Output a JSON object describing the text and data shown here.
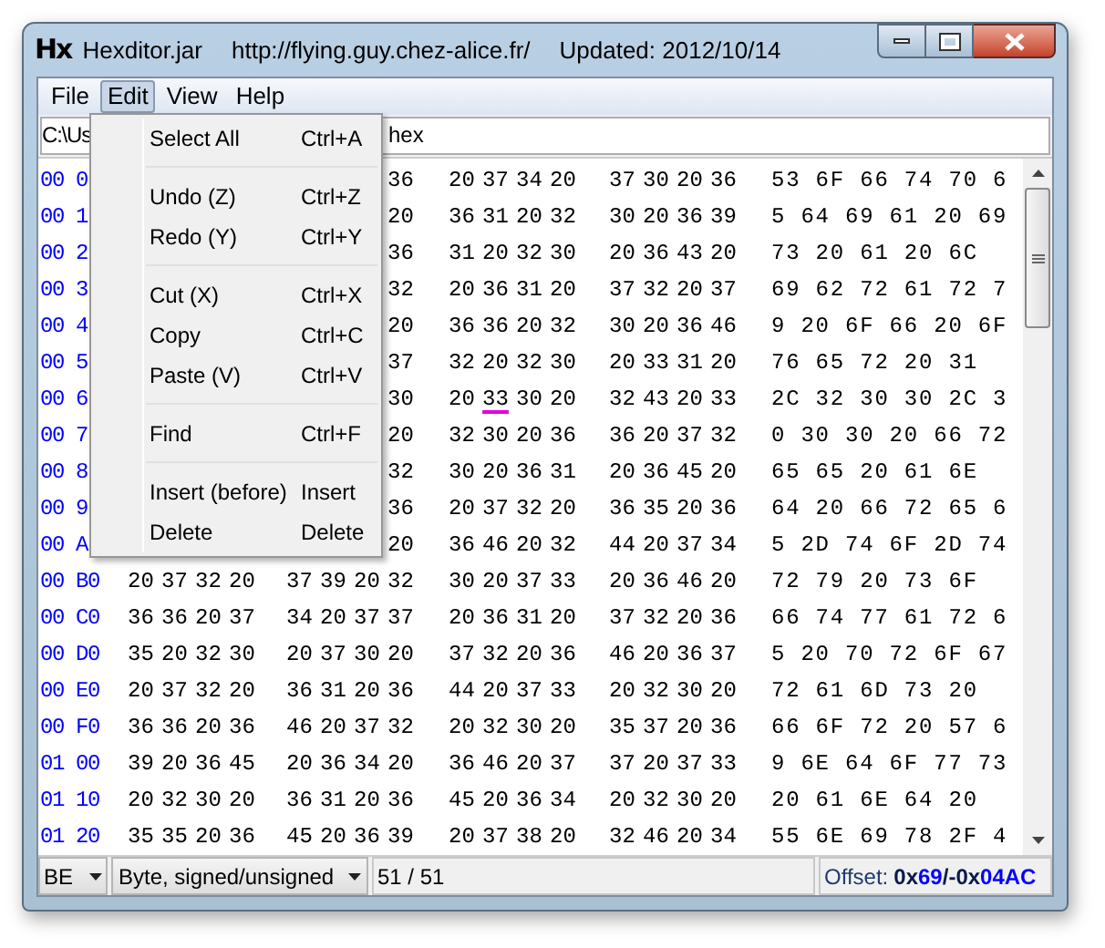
{
  "window": {
    "app_icon": "Hx",
    "title_parts": [
      "Hexditor.jar",
      "http://flying.guy.chez-alice.fr/",
      "Updated: 2012/10/14"
    ]
  },
  "menu_bar": [
    {
      "label": "File",
      "selected": false
    },
    {
      "label": "Edit",
      "selected": true
    },
    {
      "label": "View",
      "selected": false
    },
    {
      "label": "Help",
      "selected": false
    }
  ],
  "path_field": {
    "value_parts": [
      "C:\\Us",
      "hex"
    ]
  },
  "edit_menu": [
    {
      "kind": "item",
      "label": "Select All",
      "shortcut": "Ctrl+A"
    },
    {
      "kind": "separator"
    },
    {
      "kind": "item",
      "label": "Undo (Z)",
      "shortcut": "Ctrl+Z"
    },
    {
      "kind": "item",
      "label": "Redo (Y)",
      "shortcut": "Ctrl+Y"
    },
    {
      "kind": "separator"
    },
    {
      "kind": "item",
      "label": "Cut (X)",
      "shortcut": "Ctrl+X"
    },
    {
      "kind": "item",
      "label": "Copy",
      "shortcut": "Ctrl+C"
    },
    {
      "kind": "item",
      "label": "Paste (V)",
      "shortcut": "Ctrl+V"
    },
    {
      "kind": "separator"
    },
    {
      "kind": "item",
      "label": "Find",
      "shortcut": "Ctrl+F"
    },
    {
      "kind": "separator"
    },
    {
      "kind": "item",
      "label": "Insert (before)",
      "shortcut": "Insert"
    },
    {
      "kind": "item",
      "label": "Delete",
      "shortcut": "Delete"
    }
  ],
  "hex_rows": [
    {
      "address": "00 0",
      "groups": [
        [
          "36"
        ],
        [
          "20",
          "37",
          "34",
          "20"
        ],
        [
          "37",
          "30",
          "20",
          "36"
        ]
      ],
      "text": "53 6F 66 74 70 6"
    },
    {
      "address": "00 1",
      "groups": [
        [
          "20"
        ],
        [
          "36",
          "31",
          "20",
          "32"
        ],
        [
          "30",
          "20",
          "36",
          "39"
        ]
      ],
      "text": "5 64 69 61 20 69"
    },
    {
      "address": "00 2",
      "groups": [
        [
          "36"
        ],
        [
          "31",
          "20",
          "32",
          "30"
        ],
        [
          "20",
          "36",
          "43",
          "20"
        ]
      ],
      "text": "73 20 61 20 6C"
    },
    {
      "address": "00 3",
      "groups": [
        [
          "32"
        ],
        [
          "20",
          "36",
          "31",
          "20"
        ],
        [
          "37",
          "32",
          "20",
          "37"
        ]
      ],
      "text": "69 62 72 61 72 7"
    },
    {
      "address": "00 4",
      "groups": [
        [
          "20"
        ],
        [
          "36",
          "36",
          "20",
          "32"
        ],
        [
          "30",
          "20",
          "36",
          "46"
        ]
      ],
      "text": "9 20 6F 66 20 6F"
    },
    {
      "address": "00 5",
      "groups": [
        [
          "37"
        ],
        [
          "32",
          "20",
          "32",
          "30"
        ],
        [
          "20",
          "33",
          "31",
          "20"
        ]
      ],
      "text": "76 65 72 20 31"
    },
    {
      "address": "00 6",
      "groups": [
        [
          "30"
        ],
        [
          "20",
          {
            "text": "33",
            "cursor": true
          },
          "30",
          "20"
        ],
        [
          "32",
          "43",
          "20",
          "33"
        ]
      ],
      "text": "2C 32 30 30 2C 3"
    },
    {
      "address": "00 7",
      "groups": [
        [
          "20"
        ],
        [
          "32",
          "30",
          "20",
          "36"
        ],
        [
          "36",
          "20",
          "37",
          "32"
        ]
      ],
      "text": "0 30 30 20 66 72"
    },
    {
      "address": "00 8",
      "groups": [
        [
          "32"
        ],
        [
          "30",
          "20",
          "36",
          "31"
        ],
        [
          "20",
          "36",
          "45",
          "20"
        ]
      ],
      "text": "65 65 20 61 6E"
    },
    {
      "address": "00 9",
      "groups": [
        [
          "36"
        ],
        [
          "20",
          "37",
          "32",
          "20"
        ],
        [
          "36",
          "35",
          "20",
          "36"
        ]
      ],
      "text": "64 20 66 72 65 6"
    },
    {
      "address": "00 A",
      "groups": [
        [
          "20"
        ],
        [
          "36",
          "46",
          "20",
          "32"
        ],
        [
          "44",
          "20",
          "37",
          "34"
        ]
      ],
      "text": "5 2D 74 6F 2D 74"
    },
    {
      "address": "00 B0",
      "groups": [
        [
          "20",
          "37",
          "32",
          "20"
        ],
        [
          "37",
          "39",
          "20",
          "32"
        ],
        [
          "30",
          "20",
          "37",
          "33"
        ],
        [
          "20",
          "36",
          "46",
          "20"
        ]
      ],
      "text": "72 79 20 73 6F"
    },
    {
      "address": "00 C0",
      "groups": [
        [
          "36",
          "36",
          "20",
          "37"
        ],
        [
          "34",
          "20",
          "37",
          "37"
        ],
        [
          "20",
          "36",
          "31",
          "20"
        ],
        [
          "37",
          "32",
          "20",
          "36"
        ]
      ],
      "text": "66 74 77 61 72 6"
    },
    {
      "address": "00 D0",
      "groups": [
        [
          "35",
          "20",
          "32",
          "30"
        ],
        [
          "20",
          "37",
          "30",
          "20"
        ],
        [
          "37",
          "32",
          "20",
          "36"
        ],
        [
          "46",
          "20",
          "36",
          "37"
        ]
      ],
      "text": "5 20 70 72 6F 67"
    },
    {
      "address": "00 E0",
      "groups": [
        [
          "20",
          "37",
          "32",
          "20"
        ],
        [
          "36",
          "31",
          "20",
          "36"
        ],
        [
          "44",
          "20",
          "37",
          "33"
        ],
        [
          "20",
          "32",
          "30",
          "20"
        ]
      ],
      "text": "72 61 6D 73 20"
    },
    {
      "address": "00 F0",
      "groups": [
        [
          "36",
          "36",
          "20",
          "36"
        ],
        [
          "46",
          "20",
          "37",
          "32"
        ],
        [
          "20",
          "32",
          "30",
          "20"
        ],
        [
          "35",
          "37",
          "20",
          "36"
        ]
      ],
      "text": "66 6F 72 20 57 6"
    },
    {
      "address": "01 00",
      "groups": [
        [
          "39",
          "20",
          "36",
          "45"
        ],
        [
          "20",
          "36",
          "34",
          "20"
        ],
        [
          "36",
          "46",
          "20",
          "37"
        ],
        [
          "37",
          "20",
          "37",
          "33"
        ]
      ],
      "text": "9 6E 64 6F 77 73"
    },
    {
      "address": "01 10",
      "groups": [
        [
          "20",
          "32",
          "30",
          "20"
        ],
        [
          "36",
          "31",
          "20",
          "36"
        ],
        [
          "45",
          "20",
          "36",
          "34"
        ],
        [
          "20",
          "32",
          "30",
          "20"
        ]
      ],
      "text": "20 61 6E 64 20"
    },
    {
      "address": "01 20",
      "groups": [
        [
          "35",
          "35",
          "20",
          "36"
        ],
        [
          "45",
          "20",
          "36",
          "39"
        ],
        [
          "20",
          "37",
          "38",
          "20"
        ],
        [
          "32",
          "46",
          "20",
          "34"
        ]
      ],
      "text": "55 6E 69 78 2F 4"
    }
  ],
  "status_bar": {
    "endian": "BE",
    "type": "Byte, signed/unsigned",
    "position": "51 / 51",
    "offset": [
      {
        "kind": "label",
        "text": "Offset:"
      },
      {
        "kind": "prefix",
        "text": "0x"
      },
      {
        "kind": "digits",
        "text": "69"
      },
      {
        "kind": "prefix",
        "text": "/-0x"
      },
      {
        "kind": "digits",
        "text": "04AC"
      }
    ]
  }
}
